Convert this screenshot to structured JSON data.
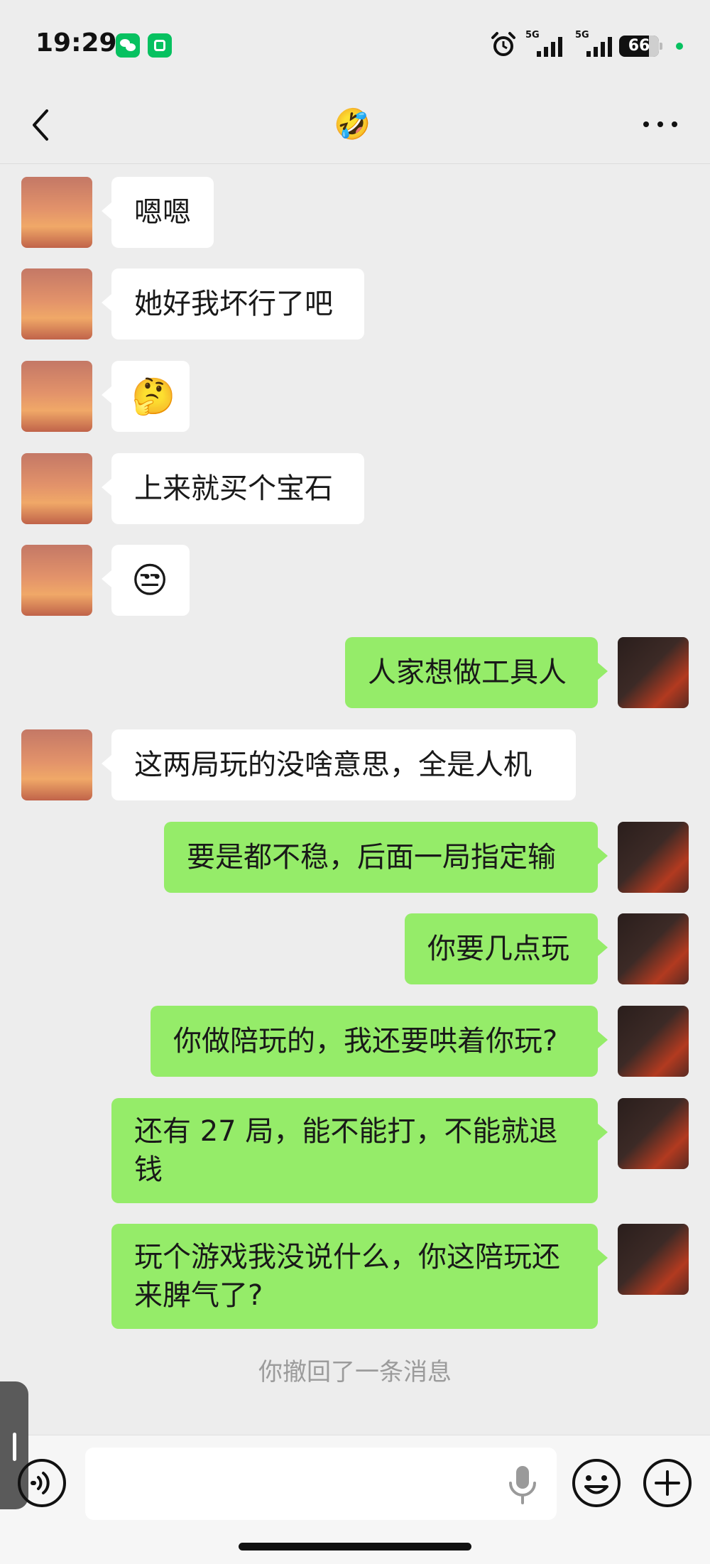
{
  "status_bar": {
    "time": "19:29",
    "network_1": "5G",
    "network_2": "5G",
    "battery": "66"
  },
  "nav": {
    "title_emoji": "🤣",
    "back_icon": "chevron-left-icon",
    "more_icon": "more-icon"
  },
  "messages": [
    {
      "side": "left",
      "text": "嗯嗯"
    },
    {
      "side": "left",
      "text": "她好我坏行了吧"
    },
    {
      "side": "left",
      "text": "🤔"
    },
    {
      "side": "left",
      "text": "上来就买个宝石"
    },
    {
      "side": "left",
      "text": "😒"
    },
    {
      "side": "right",
      "text": "人家想做工具人"
    },
    {
      "side": "left",
      "text": "这两局玩的没啥意思，全是人机"
    },
    {
      "side": "right",
      "text": "要是都不稳，后面一局指定输"
    },
    {
      "side": "right",
      "text": "你要几点玩"
    },
    {
      "side": "right",
      "text": "你做陪玩的，我还要哄着你玩?"
    },
    {
      "side": "right",
      "text_lines": [
        "还有 27 局，能不能打，不能就退",
        "钱"
      ]
    },
    {
      "side": "right",
      "text_lines": [
        "玩个游戏我没说什么，你这陪玩还",
        "来脾气了?"
      ]
    }
  ],
  "recall_notice": "你撤回了一条消息",
  "input_bar": {
    "placeholder": "",
    "icons": [
      "voice-icon",
      "mic-icon",
      "emoji-icon",
      "plus-icon"
    ]
  },
  "colors": {
    "background": "#ededed",
    "bubble_self": "#95ec69",
    "bubble_other": "#ffffff",
    "brand": "#07c160"
  }
}
